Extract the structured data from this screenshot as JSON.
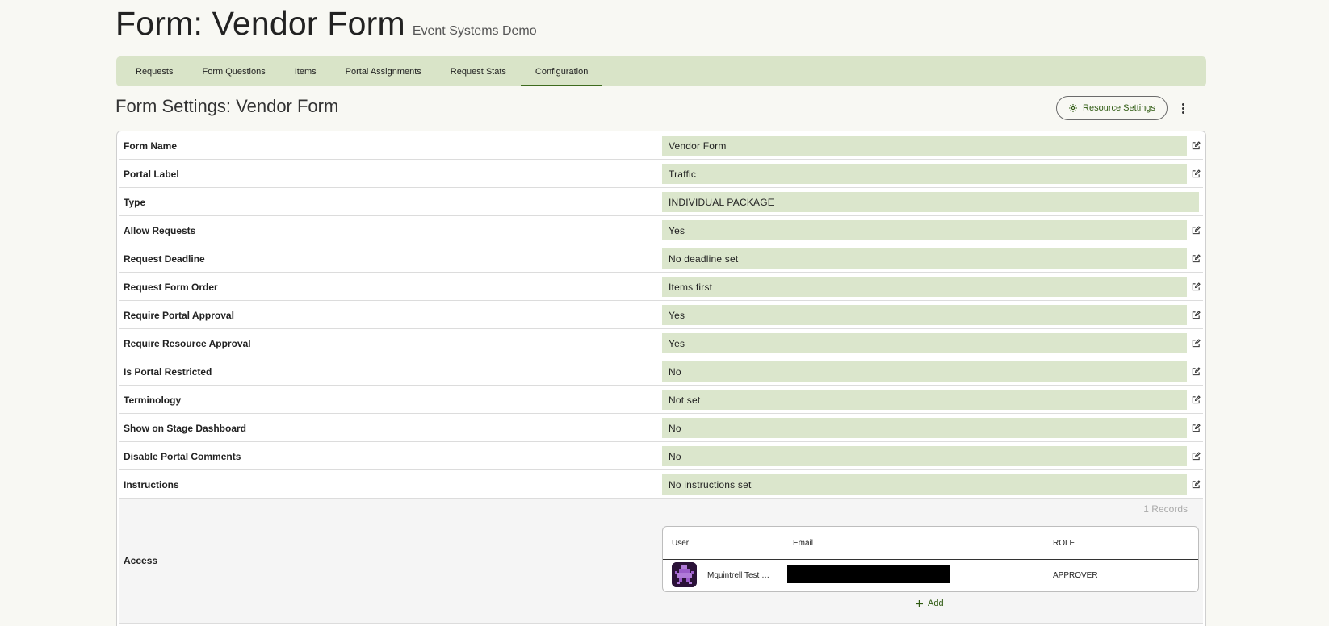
{
  "header": {
    "title": "Form: Vendor Form",
    "subtitle": "Event Systems Demo"
  },
  "tabs": [
    {
      "label": "Requests"
    },
    {
      "label": "Form Questions"
    },
    {
      "label": "Items"
    },
    {
      "label": "Portal Assignments"
    },
    {
      "label": "Request Stats"
    },
    {
      "label": "Configuration",
      "active": true
    }
  ],
  "section": {
    "title": "Form Settings: Vendor Form",
    "resource_settings_label": "Resource Settings"
  },
  "settings": [
    {
      "label": "Form Name",
      "value": "Vendor Form",
      "editable": true
    },
    {
      "label": "Portal Label",
      "value": "Traffic",
      "editable": true
    },
    {
      "label": "Type",
      "value": "INDIVIDUAL PACKAGE",
      "editable": false
    },
    {
      "label": "Allow Requests",
      "value": "Yes",
      "editable": true
    },
    {
      "label": "Request Deadline",
      "value": "No deadline set",
      "editable": true
    },
    {
      "label": "Request Form Order",
      "value": "Items first",
      "editable": true
    },
    {
      "label": "Require Portal Approval",
      "value": "Yes",
      "editable": true
    },
    {
      "label": "Require Resource Approval",
      "value": "Yes",
      "editable": true
    },
    {
      "label": "Is Portal Restricted",
      "value": "No",
      "editable": true
    },
    {
      "label": "Terminology",
      "value": "Not set",
      "editable": true
    },
    {
      "label": "Show on Stage Dashboard",
      "value": "No",
      "editable": true
    },
    {
      "label": "Disable Portal Comments",
      "value": "No",
      "editable": true
    },
    {
      "label": "Instructions",
      "value": "No instructions set",
      "editable": true
    }
  ],
  "access": {
    "label": "Access",
    "records_count": "1 Records",
    "columns": {
      "user": "User",
      "email": "Email",
      "role": "ROLE"
    },
    "rows": [
      {
        "user": "Mquintrell Test …",
        "email": "",
        "role": "APPROVER"
      }
    ],
    "add_label": "Add"
  },
  "colors": {
    "accent": "#3e6b1e",
    "tab_bar": "#d9e4c8",
    "value_bg": "#dbe6cc",
    "link_green": "#2f5b12"
  },
  "icons": {
    "edit": "edit-icon",
    "resource_settings": "gear-icon",
    "more": "more-vert-icon",
    "add": "plus-icon"
  }
}
